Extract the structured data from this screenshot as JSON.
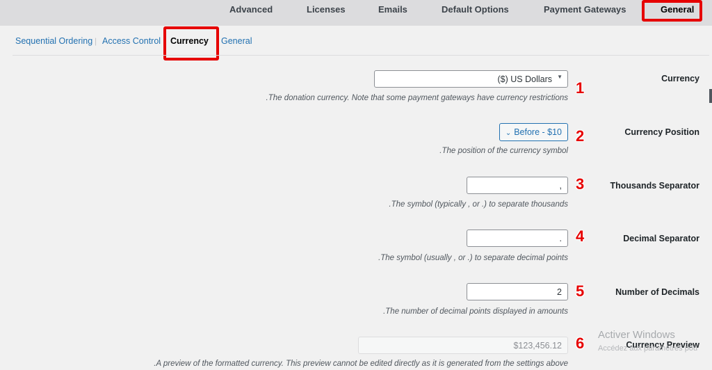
{
  "top_tabs": [
    "Advanced",
    "Licenses",
    "Emails",
    "Default Options",
    "Payment Gateways",
    "General"
  ],
  "sub_nav": {
    "items": [
      "Sequential Ordering",
      "Access Control",
      "Currency",
      "General"
    ],
    "separator": "|"
  },
  "fields": {
    "currency": {
      "label": "Currency",
      "value": "($) US Dollars",
      "description": ".The donation currency. Note that some payment gateways have currency restrictions",
      "marker": "1"
    },
    "currency_position": {
      "label": "Currency Position",
      "value": "Before - $10",
      "description": ".The position of the currency symbol",
      "marker": "2"
    },
    "thousands_separator": {
      "label": "Thousands Separator",
      "value": ",",
      "description": ".The symbol (typically , or .) to separate thousands",
      "marker": "3"
    },
    "decimal_separator": {
      "label": "Decimal Separator",
      "value": ".",
      "description": ".The symbol (usually , or .) to separate decimal points",
      "marker": "4"
    },
    "number_of_decimals": {
      "label": "Number of Decimals",
      "value": "2",
      "description": ".The number of decimal points displayed in amounts",
      "marker": "5"
    },
    "currency_preview": {
      "label": "Currency Preview",
      "value": "$123,456.12",
      "description": ".A preview of the formatted currency. This preview cannot be edited directly as it is generated from the settings above",
      "marker": "6"
    }
  },
  "watermark": {
    "line1": "Activer Windows",
    "line2": "Accédez aux paramètres pou"
  },
  "colors": {
    "highlight": "#e60000",
    "link": "#2271b1",
    "topbar_bg": "#dcdcde",
    "page_bg": "#f1f1f1"
  }
}
